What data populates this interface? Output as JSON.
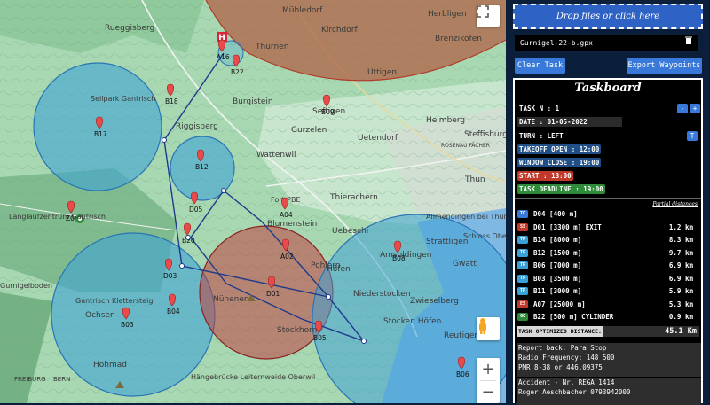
{
  "map": {
    "labels": [
      {
        "id": "Ruegglsberg",
        "text": "Rueggisberg"
      },
      {
        "id": "Muhledorf",
        "text": "Mühledorf"
      },
      {
        "id": "Kirchdorf",
        "text": "Kirchdorf"
      },
      {
        "id": "Herbligen",
        "text": "Herbligen"
      },
      {
        "id": "Brenzikofen",
        "text": "Brenzikofen"
      },
      {
        "id": "Uttigen",
        "text": "Uttigen"
      },
      {
        "id": "Thurnen",
        "text": "Thurnen"
      },
      {
        "id": "Burgistein",
        "text": "Burgistein"
      },
      {
        "id": "Seftigen",
        "text": "Seftigen"
      },
      {
        "id": "Gurzelen",
        "text": "Gurzelen"
      },
      {
        "id": "Uetendorf",
        "text": "Uetendorf"
      },
      {
        "id": "Heimberg",
        "text": "Heimberg"
      },
      {
        "id": "Steffisburg",
        "text": "Steffisburg"
      },
      {
        "id": "Wattenwil",
        "text": "Wattenwil"
      },
      {
        "id": "Riggisberg",
        "text": "Riggisberg"
      },
      {
        "id": "Thierachern",
        "text": "Thierachern"
      },
      {
        "id": "Blumenstein",
        "text": "Blumenstein"
      },
      {
        "id": "Uebeschi",
        "text": "Uebeschi"
      },
      {
        "id": "Pohlern",
        "text": "Pohlern"
      },
      {
        "id": "Hofen",
        "text": "Höfen"
      },
      {
        "id": "Amsoldingen",
        "text": "Amsoldingen"
      },
      {
        "id": "Strattligen",
        "text": "Strättligen"
      },
      {
        "id": "Gwatt",
        "text": "Gwatt"
      },
      {
        "id": "Niederstocken",
        "text": "Niederstocken"
      },
      {
        "id": "Zwieselberg",
        "text": "Zwieselberg"
      },
      {
        "id": "Stocken",
        "text": "Stocken Höfen"
      },
      {
        "id": "Reutigen",
        "text": "Reutigen"
      },
      {
        "id": "Stockhorn",
        "text": "Stockhorn"
      },
      {
        "id": "Nunenen",
        "text": "Nünenen"
      },
      {
        "id": "Ochsen",
        "text": "Ochsen"
      },
      {
        "id": "Hohmad",
        "text": "Hohmad"
      },
      {
        "id": "Gantrisch",
        "text": "Gantrisch Klettersteig"
      },
      {
        "id": "Langlauf",
        "text": "Langlaufzentrum Gantrisch"
      },
      {
        "id": "Seilpark",
        "text": "Seilpark Gantrisch"
      },
      {
        "id": "Hangebrucke",
        "text": "Hängebrücke Leiternweide Oberwil"
      },
      {
        "id": "Allmendingen",
        "text": "Allmendingen bei Thun"
      },
      {
        "id": "Schloss",
        "text": "Schloss Oberhofen"
      },
      {
        "id": "Thun",
        "text": "Thun"
      },
      {
        "id": "Fribourg",
        "text": "FREIBURG"
      },
      {
        "id": "Bern",
        "text": "BERN"
      },
      {
        "id": "Gurnigelboden",
        "text": "Gurnigelboden"
      },
      {
        "id": "Rosenau",
        "text": "ROSENAU FÄCHER"
      },
      {
        "id": "FortPBE",
        "text": "Fort PBE"
      }
    ],
    "waypoints": [
      {
        "id": "A16",
        "text": "A16"
      },
      {
        "id": "B22",
        "text": "B22"
      },
      {
        "id": "B18",
        "text": "B18"
      },
      {
        "id": "B09",
        "text": "B09"
      },
      {
        "id": "B17",
        "text": "B17"
      },
      {
        "id": "B12",
        "text": "B12"
      },
      {
        "id": "D05",
        "text": "D05"
      },
      {
        "id": "A04",
        "text": "A04"
      },
      {
        "id": "A02",
        "text": "A02"
      },
      {
        "id": "B20",
        "text": "B20"
      },
      {
        "id": "D03",
        "text": "D03"
      },
      {
        "id": "B04",
        "text": "B04"
      },
      {
        "id": "B03",
        "text": "B03"
      },
      {
        "id": "D01",
        "text": "D01"
      },
      {
        "id": "B05",
        "text": "B05"
      },
      {
        "id": "B08",
        "text": "B08"
      },
      {
        "id": "B06",
        "text": "B06"
      },
      {
        "id": "Z0",
        "text": "Z0"
      }
    ],
    "colors": {
      "cylinder_blue": "#3fa3d6",
      "cylinder_red": "#c04040",
      "route": "#1f3a8a"
    },
    "controls": {
      "fullscreen_icon": "fullscreen-icon",
      "zoom_in": "+",
      "zoom_out": "−",
      "pegman_icon": "pegman-icon"
    }
  },
  "panel": {
    "drop_label": "Drop files or click here",
    "file_name": "Gurnigel-22-b.gpx",
    "trash_icon": "trash-icon",
    "clear_task": "Clear Task",
    "export_waypoints": "Export Waypoints",
    "taskboard_title": "Taskboard",
    "task_n": "TASK N : 1",
    "date": "DATE : 01-05-2022",
    "turn": "TURN : LEFT",
    "turn_btn": "T",
    "minus_btn": "-",
    "plus_btn": "+",
    "takeoff_open": "TAKEOFF OPEN : 12:00",
    "window_close": "WINDOW CLOSE : 19:00",
    "start": "START : 13:00",
    "task_deadline": "TASK DEADLINE : 19:00",
    "partial_distances": "Partial distances",
    "turnpoints": [
      {
        "badge": "TO",
        "color": "#3879d9",
        "name": "D04 [400 m]",
        "dist": ""
      },
      {
        "badge": "SS",
        "color": "#c0392b",
        "name": "D01 [3300 m] EXIT",
        "dist": "1.2 km"
      },
      {
        "badge": "TP",
        "color": "#3aa0d8",
        "name": "B14 [8000 m]",
        "dist": "8.3 km"
      },
      {
        "badge": "TP",
        "color": "#3aa0d8",
        "name": "B12 [1500 m]",
        "dist": "9.7 km"
      },
      {
        "badge": "TP",
        "color": "#3aa0d8",
        "name": "B06 [7000 m]",
        "dist": "6.9 km"
      },
      {
        "badge": "TP",
        "color": "#3aa0d8",
        "name": "B03 [3500 m]",
        "dist": "6.9 km"
      },
      {
        "badge": "TP",
        "color": "#3aa0d8",
        "name": "B11 [3000 m]",
        "dist": "5.9 km"
      },
      {
        "badge": "ES",
        "color": "#c0392b",
        "name": "A07 [25000 m]",
        "dist": "5.3 km"
      },
      {
        "badge": "GO",
        "color": "#2e8b3a",
        "name": "B22 [500 m] CYLINDER",
        "dist": "0.9 km"
      }
    ],
    "optimized_label": "TASK OPTIMIZED DISTANCE:",
    "optimized_value": "45.1 Km",
    "report_back": "Report back: Para Stop",
    "radio": "Radio Frequency: 148 500",
    "pmr": "PMR 8-38 or 446.09375",
    "accident": "Accident - Nr. REGA 1414",
    "contact": "Roger Aeschbacher 0793942000"
  }
}
